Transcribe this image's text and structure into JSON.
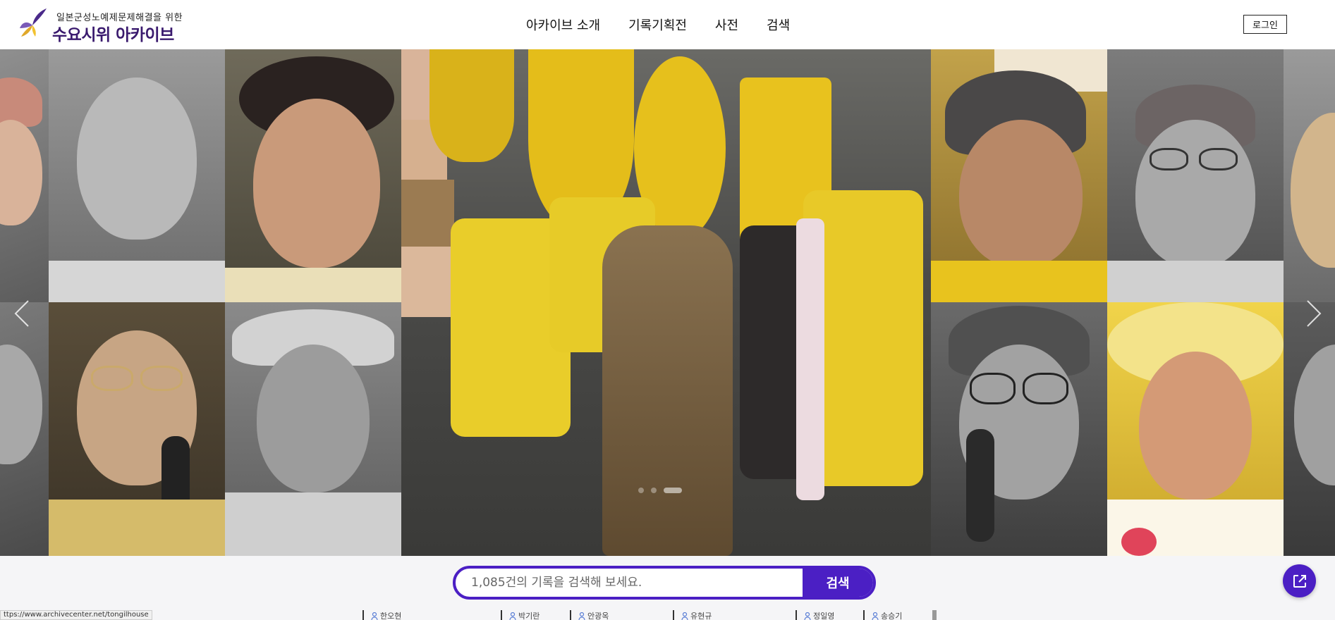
{
  "header": {
    "logo_subtitle": "일본군성노예제문제해결을 위한",
    "logo_title": "수요시위 아카이브",
    "nav": [
      {
        "label": "아카이브 소개"
      },
      {
        "label": "기록기획전"
      },
      {
        "label": "사전"
      },
      {
        "label": "검색"
      }
    ],
    "login_label": "로그인"
  },
  "banner": {
    "prev_icon": "chevron-left-icon",
    "next_icon": "chevron-right-icon",
    "slide_count": 3,
    "active_slide": 3
  },
  "search": {
    "placeholder": "1,085건의 기록을 검색해 보세요.",
    "button_label": "검색"
  },
  "floating_button_icon": "external-link-icon",
  "names": [
    "한오현",
    "박기란",
    "안광옥",
    "유현규",
    "정일영",
    "송승기"
  ],
  "status_bar_url": "ttps://www.archivecenter.net/tongilhouse",
  "colors": {
    "accent": "#4b1fc4",
    "logo_text": "#3a1a6e"
  }
}
